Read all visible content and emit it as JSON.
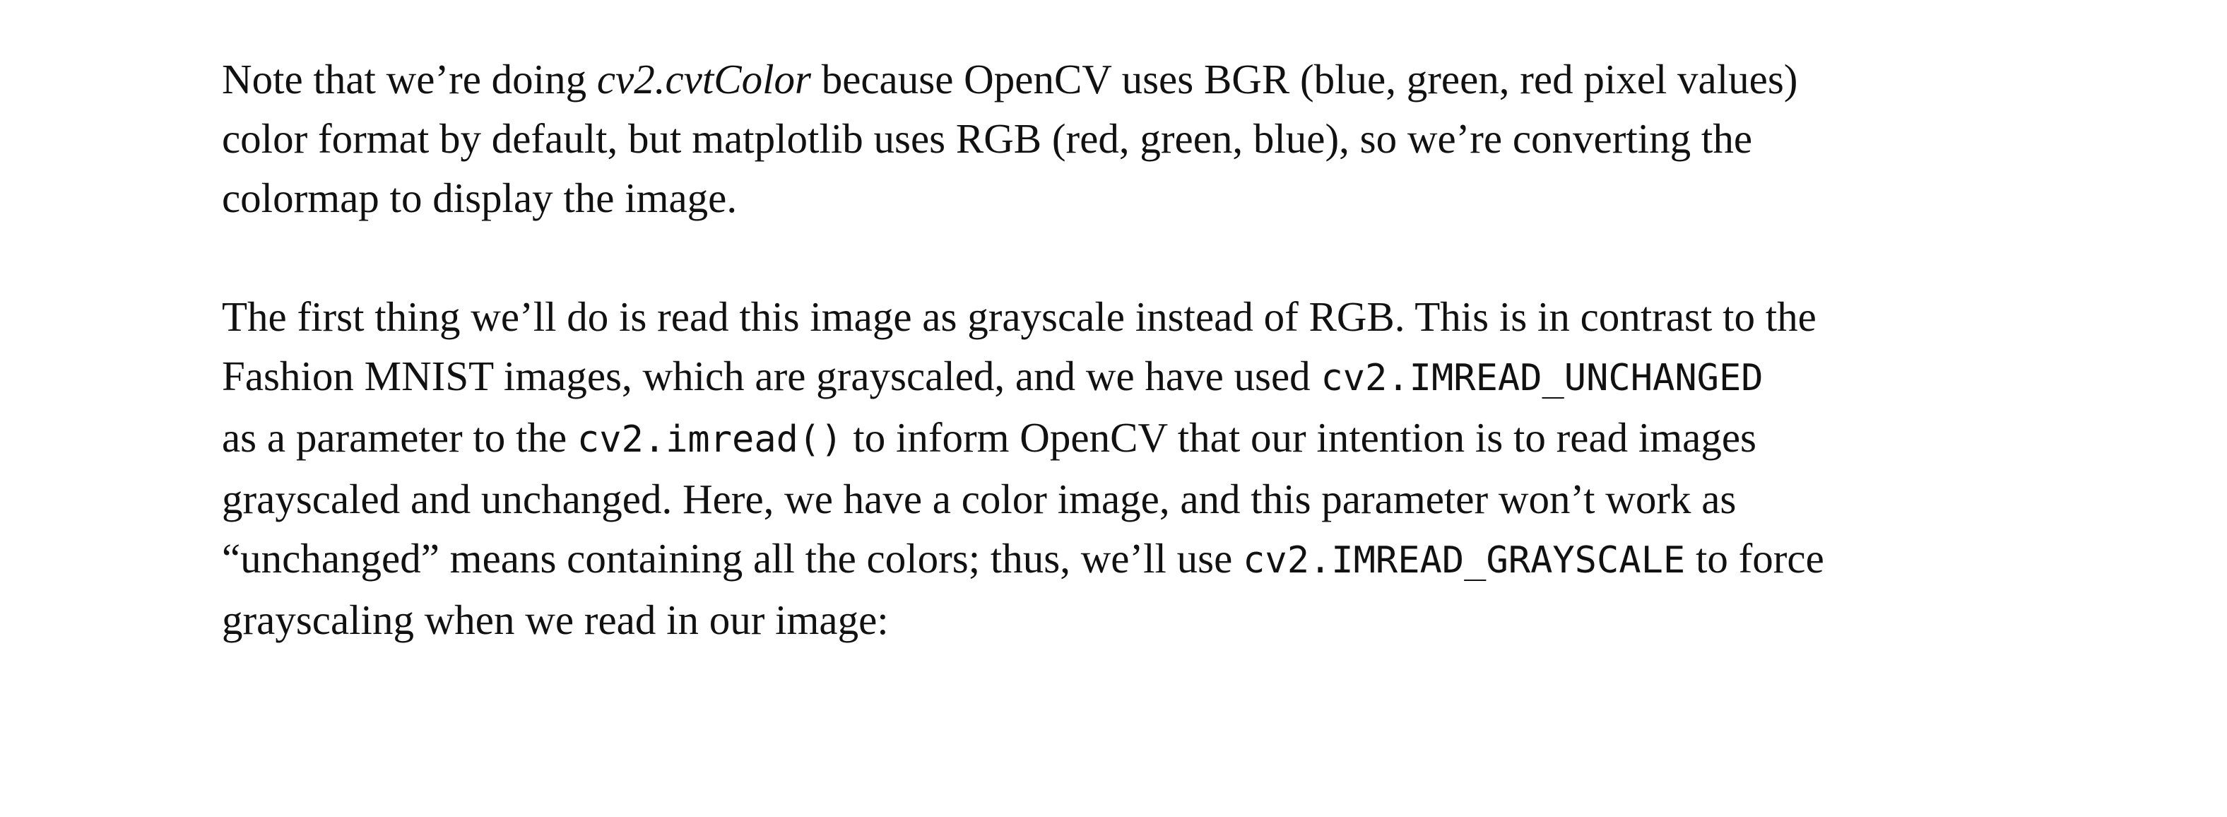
{
  "document": {
    "paragraph1": {
      "line1": {
        "t1": "Note that we’re doing ",
        "em": "cv2.cvtColor",
        "t2": " because OpenCV uses BGR (blue, green, red pixel values)"
      },
      "line2": "color format by default, but matplotlib uses RGB (red, green, blue), so we’re converting the",
      "line3": "colormap to display the image."
    },
    "paragraph2": {
      "line1": "The first thing we’ll do is read this image as grayscale instead of RGB. This is in contrast to the",
      "line2": {
        "t1": "Fashion MNIST images, which are grayscaled, and we have used ",
        "code": "cv2.IMREAD_UNCHANGED"
      },
      "line3": {
        "t1": "as a parameter to the ",
        "code": "cv2.imread()",
        "t2": " to inform OpenCV that our intention is to read images"
      },
      "line4": "grayscaled and unchanged. Here, we have a color image, and this parameter won’t work as",
      "line5": {
        "t1": "“unchanged” means containing all the colors; thus, we’ll use ",
        "code": "cv2.IMREAD_GRAYSCALE",
        "t2": " to force"
      },
      "line6": "grayscaling when we read in our image:"
    }
  }
}
